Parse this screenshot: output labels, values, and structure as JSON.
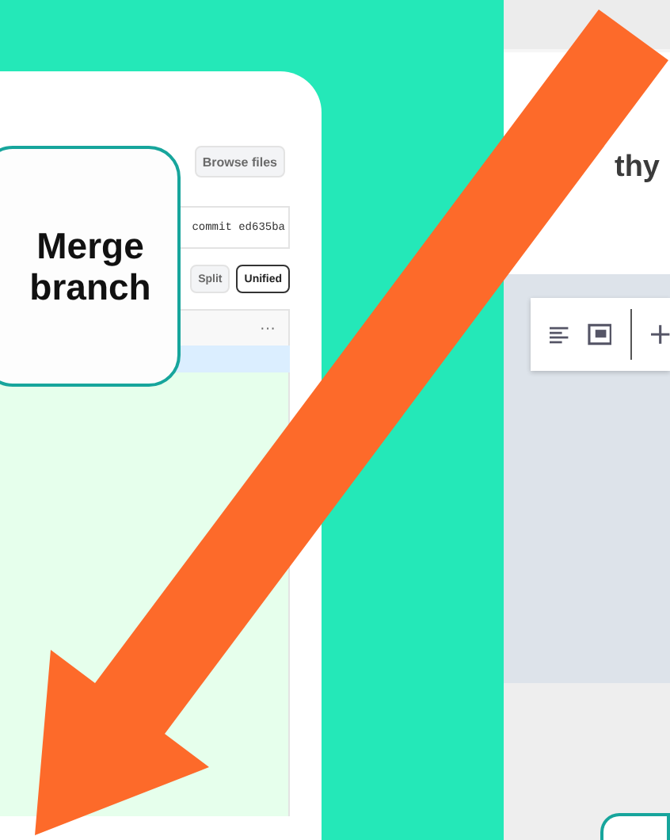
{
  "diff_view": {
    "browse_button": "Browse files",
    "commit": "commit ed635ba",
    "view_buttons": [
      {
        "label": "Split",
        "selected": false
      },
      {
        "label": "Unified",
        "selected": true
      }
    ],
    "file_menu": "···"
  },
  "callout": {
    "text": "Merge branch"
  },
  "editor": {
    "title_fragment": "thy"
  }
}
